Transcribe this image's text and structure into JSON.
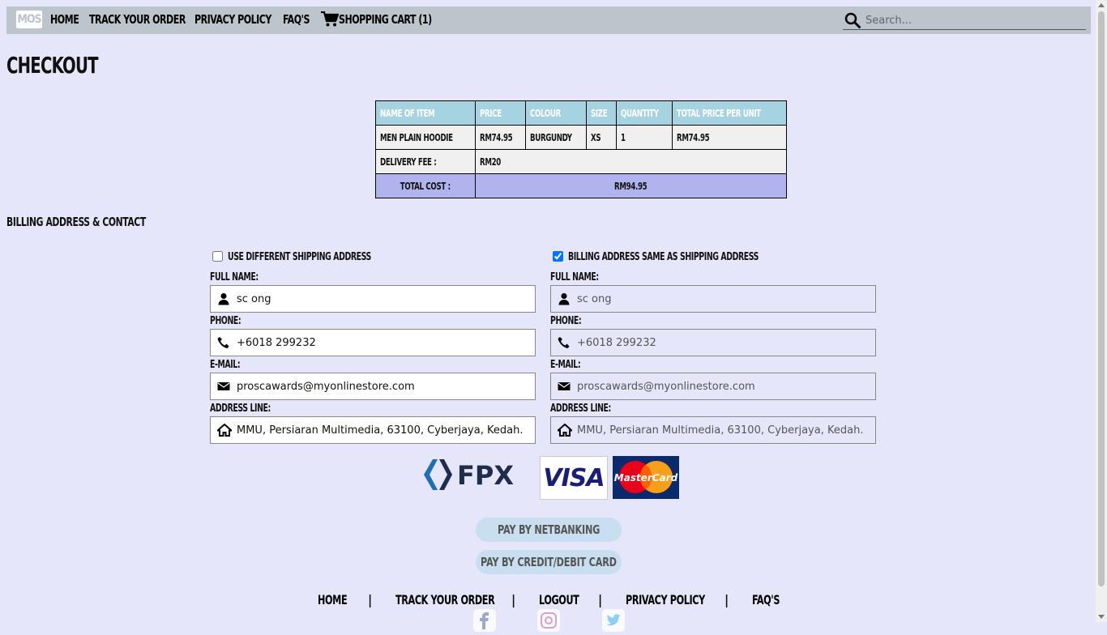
{
  "nav": {
    "logo": "MOS",
    "home": "HOME",
    "track": "TRACK YOUR ORDER",
    "privacy": "PRIVACY POLICY",
    "faq": "FAQ'S",
    "cart": "SHOPPING CART (1)",
    "search_placeholder": "Search..."
  },
  "page_title": "CHECKOUT",
  "order_table": {
    "headers": [
      "NAME OF ITEM",
      "PRICE",
      "COLOUR",
      "SIZE",
      "QUANTITY",
      "TOTAL PRICE PER UNIT"
    ],
    "item": {
      "name": "MEN PLAIN HOODIE",
      "price": "RM74.95",
      "colour": "BURGUNDY",
      "size": "XS",
      "quantity": "1",
      "total": "RM74.95"
    },
    "delivery_label": "DELIVERY FEE :",
    "delivery_value": "RM20",
    "total_label": "TOTAL COST :",
    "total_value": "RM94.95"
  },
  "section_title": "BILLING ADDRESS & CONTACT",
  "shipping": {
    "checkbox_label": "USE DIFFERENT SHIPPING ADDRESS",
    "checked": false,
    "fullname_label": "FULL NAME:",
    "fullname": "sc ong",
    "phone_label": "PHONE:",
    "phone": "+6018 299232",
    "email_label": "E-MAIL:",
    "email": "proscawards@myonlinestore.com",
    "address_label": "ADDRESS LINE:",
    "address": "MMU, Persiaran Multimedia, 63100, Cyberjaya, Kedah."
  },
  "billing": {
    "checkbox_label": "BILLING ADDRESS SAME AS SHIPPING ADDRESS",
    "checked": true,
    "fullname_label": "FULL NAME:",
    "fullname": "sc ong",
    "phone_label": "PHONE:",
    "phone": "+6018 299232",
    "email_label": "E-MAIL:",
    "email": "proscawards@myonlinestore.com",
    "address_label": "ADDRESS LINE:",
    "address": "MMU, Persiaran Multimedia, 63100, Cyberjaya, Kedah."
  },
  "payment_logos": {
    "fpx": "FPX",
    "visa": "VISA",
    "mastercard": "MasterCard"
  },
  "buttons": {
    "netbanking": "PAY BY NETBANKING",
    "card": "PAY BY CREDIT/DEBIT CARD"
  },
  "footer": {
    "home": "HOME",
    "track": "TRACK YOUR ORDER",
    "logout": "LOGOUT",
    "privacy": "PRIVACY POLICY",
    "faq": "FAQ'S",
    "separator": "|"
  },
  "icons": {
    "cart": "cart-icon",
    "search": "search-icon",
    "user": "user-icon",
    "phone": "phone-icon",
    "email": "envelope-icon",
    "address": "home-icon",
    "social": [
      "facebook-icon",
      "instagram-icon",
      "twitter-icon"
    ]
  },
  "colors": {
    "background": "#e6e6fa",
    "nav_bg": "#bcc4cc",
    "table_header": "#a6d3e2",
    "total_row": "#b0b3ee",
    "pay_button": "#c9def0"
  }
}
